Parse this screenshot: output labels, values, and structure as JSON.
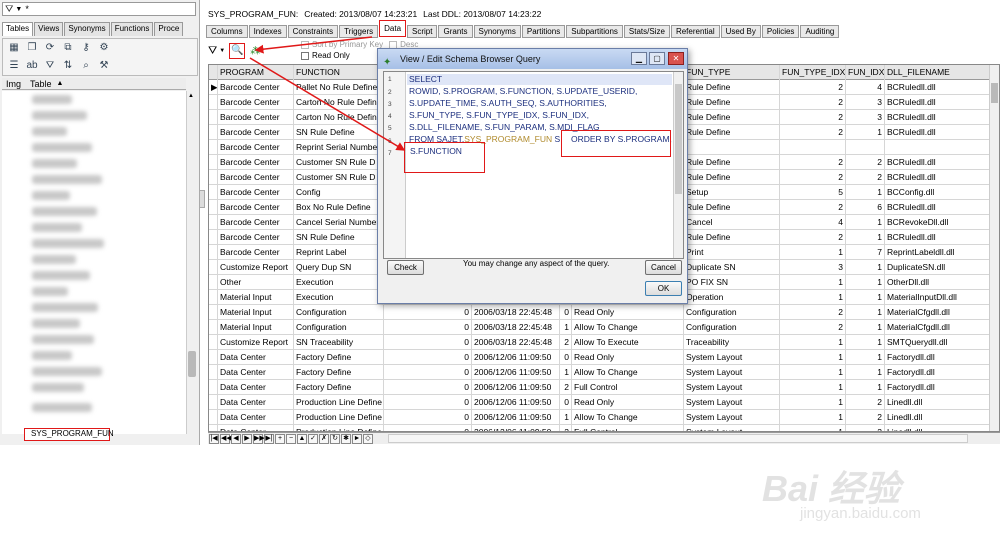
{
  "left_panel": {
    "filter_value": "*",
    "tabs": [
      "Tables",
      "Views",
      "Synonyms",
      "Functions",
      "Proce"
    ],
    "col_img": "Img",
    "col_table": "Table",
    "selected_table": "SYS_PROGRAM_FUN"
  },
  "header": {
    "object_name": "SYS_PROGRAM_FUN:",
    "created": "Created: 2013/08/07 14:23:21",
    "last_ddl": "Last DDL: 2013/08/07 14:23:22"
  },
  "tabs": [
    "Columns",
    "Indexes",
    "Constraints",
    "Triggers",
    "Data",
    "Script",
    "Grants",
    "Synonyms",
    "Partitions",
    "Subpartitions",
    "Stats/Size",
    "Referential",
    "Used By",
    "Policies",
    "Auditing"
  ],
  "toolbar": {
    "sort_by_pk": "Sort by Primary Key",
    "read_only": "Read Only",
    "desc": "Desc"
  },
  "grid": {
    "columns": [
      "PROGRAM",
      "FUNCTION",
      "",
      "",
      "",
      "FUN_TYPE",
      "FUN_TYPE_IDX",
      "FUN_IDX",
      "DLL_FILENAME"
    ],
    "rows": [
      [
        "Barcode Center",
        "Pallet No Rule Define",
        "",
        "",
        "",
        "Rule Define",
        "2",
        "4",
        "BCRuledll.dll"
      ],
      [
        "Barcode Center",
        "Carton No Rule Define",
        "",
        "",
        "",
        "Rule Define",
        "2",
        "3",
        "BCRuledll.dll"
      ],
      [
        "Barcode Center",
        "Carton No Rule Define",
        "",
        "",
        "",
        "Rule Define",
        "2",
        "3",
        "BCRuledll.dll"
      ],
      [
        "Barcode Center",
        "SN Rule Define",
        "",
        "",
        "",
        "Rule Define",
        "2",
        "1",
        "BCRuledll.dll"
      ],
      [
        "Barcode Center",
        "Reprint Serial Number",
        "",
        "",
        "",
        "",
        "",
        "",
        ""
      ],
      [
        "Barcode Center",
        "Customer SN Rule D",
        "",
        "",
        "",
        "Rule Define",
        "2",
        "2",
        "BCRuledll.dll"
      ],
      [
        "Barcode Center",
        "Customer SN Rule D",
        "",
        "",
        "",
        "Rule Define",
        "2",
        "2",
        "BCRuledll.dll"
      ],
      [
        "Barcode Center",
        "Config",
        "",
        "",
        "",
        "Setup",
        "5",
        "1",
        "BCConfig.dll"
      ],
      [
        "Barcode Center",
        "Box No Rule Define",
        "",
        "",
        "",
        "Rule Define",
        "2",
        "6",
        "BCRuledll.dll"
      ],
      [
        "Barcode Center",
        "Cancel Serial Number",
        "",
        "",
        "",
        "Cancel",
        "4",
        "1",
        "BCRevokeDll.dll"
      ],
      [
        "Barcode Center",
        "SN Rule Define",
        "",
        "",
        "",
        "Rule Define",
        "2",
        "1",
        "BCRuledll.dll"
      ],
      [
        "Barcode Center",
        "Reprint Label",
        "",
        "",
        "",
        "Print",
        "1",
        "7",
        "ReprintLabeldll.dll"
      ],
      [
        "Customize Report",
        "Query Dup SN",
        "",
        "",
        "",
        "Duplicate SN",
        "3",
        "1",
        "DuplicateSN.dll"
      ],
      [
        "Other",
        "Execution",
        "",
        "",
        "",
        "PO FIX SN",
        "1",
        "1",
        "OtherDll.dll"
      ],
      [
        "Material Input",
        "Execution",
        "",
        "",
        "",
        "Operation",
        "1",
        "1",
        "MaterialInputDll.dll"
      ],
      [
        "Material Input",
        "Configuration",
        "0",
        "2006/03/18 22:45:48",
        "0",
        "Read Only",
        "Configuration",
        "2",
        "1",
        "MaterialCfgdll.dll"
      ],
      [
        "Material Input",
        "Configuration",
        "0",
        "2006/03/18 22:45:48",
        "1",
        "Allow To Change",
        "Configuration",
        "2",
        "1",
        "MaterialCfgdll.dll"
      ],
      [
        "Customize Report",
        "SN Traceability",
        "0",
        "2006/03/18 22:45:48",
        "2",
        "Allow To Execute",
        "Traceability",
        "1",
        "1",
        "SMTQuerydll.dll"
      ],
      [
        "Data Center",
        "Factory Define",
        "0",
        "2006/12/06 11:09:50",
        "0",
        "Read Only",
        "System Layout",
        "1",
        "1",
        "Factorydll.dll"
      ],
      [
        "Data Center",
        "Factory Define",
        "0",
        "2006/12/06 11:09:50",
        "1",
        "Allow To Change",
        "System Layout",
        "1",
        "1",
        "Factorydll.dll"
      ],
      [
        "Data Center",
        "Factory Define",
        "0",
        "2006/12/06 11:09:50",
        "2",
        "Full Control",
        "System Layout",
        "1",
        "1",
        "Factorydll.dll"
      ],
      [
        "Data Center",
        "Production Line Define",
        "0",
        "2006/12/06 11:09:50",
        "0",
        "Read Only",
        "System Layout",
        "1",
        "2",
        "Linedll.dll"
      ],
      [
        "Data Center",
        "Production Line Define",
        "0",
        "2006/12/06 11:09:50",
        "1",
        "Allow To Change",
        "System Layout",
        "1",
        "2",
        "Linedll.dll"
      ],
      [
        "Data Center",
        "Production Line Define",
        "0",
        "2006/12/06 11:09:50",
        "2",
        "Full Control",
        "System Layout",
        "1",
        "2",
        "Linedll.dll"
      ]
    ]
  },
  "dialog": {
    "title": "View / Edit Schema Browser Query",
    "line_numbers": [
      "1",
      "2",
      "3",
      "4",
      "5",
      "6",
      "7"
    ],
    "code_lines": [
      "SELECT",
      "   ROWID, S.PROGRAM, S.FUNCTION, S.UPDATE_USERID,",
      "   S.UPDATE_TIME, S.AUTH_SEQ, S.AUTHORITIES,",
      "   S.FUN_TYPE, S.FUN_TYPE_IDX, S.FUN_IDX,",
      "   S.DLL_FILENAME, S.FUN_PARAM, S.MDI_FLAG"
    ],
    "from_kw": "FROM SAJET.",
    "from_table": "SYS_PROGRAM_FUN",
    "from_alias": " S",
    "order_by": "ORDER BY S.PROGRAM,",
    "order_by_2": "S.FUNCTION",
    "check_label": "Check",
    "hint": "You may change any aspect of the query.",
    "cancel_label": "Cancel",
    "ok_label": "OK"
  },
  "watermark": {
    "logo": "Bai  经验",
    "url": "jingyan.baidu.com"
  }
}
